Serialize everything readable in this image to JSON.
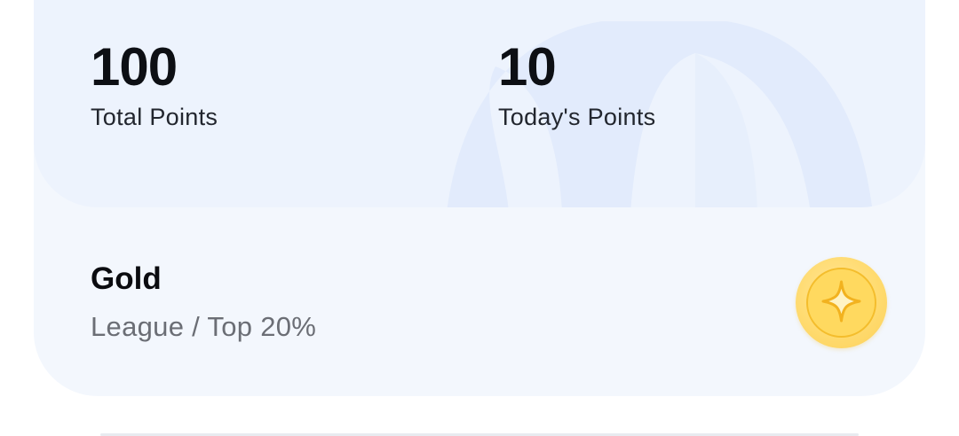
{
  "stats": {
    "total": {
      "value": "100",
      "label": "Total Points"
    },
    "today": {
      "value": "10",
      "label": "Today's Points"
    }
  },
  "league": {
    "title": "Gold",
    "subtitle": "League / Top 20%",
    "badge_icon": "gold-coin-star-icon"
  },
  "colors": {
    "card_background": "#f3f7fd",
    "stats_background": "#edf3fd",
    "decoration": "#e2ebfc",
    "coin_gold": "#ffd95f",
    "coin_rim": "#f4bd2c"
  }
}
